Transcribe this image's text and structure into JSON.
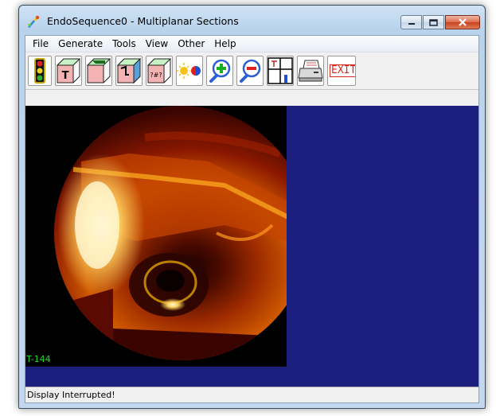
{
  "window": {
    "title": "EndoSequence0 - Multiplanar Sections"
  },
  "menu": [
    "File",
    "Generate",
    "Tools",
    "View",
    "Other",
    "Help"
  ],
  "toolbar": {
    "buttons": [
      "traffic-light-icon",
      "cube-t-icon",
      "cube-c-icon",
      "cube-s-icon",
      "cube-question-icon",
      "sun-color-icon",
      "zoom-in-icon",
      "zoom-out-icon",
      "multiplanar-grid-icon",
      "printer-icon",
      "exit-icon"
    ],
    "exit_label": "EXIT"
  },
  "viewer": {
    "frame_label": "T-144",
    "background_color": "#1c1f7d"
  },
  "status": {
    "text": "Display Interrupted!"
  }
}
